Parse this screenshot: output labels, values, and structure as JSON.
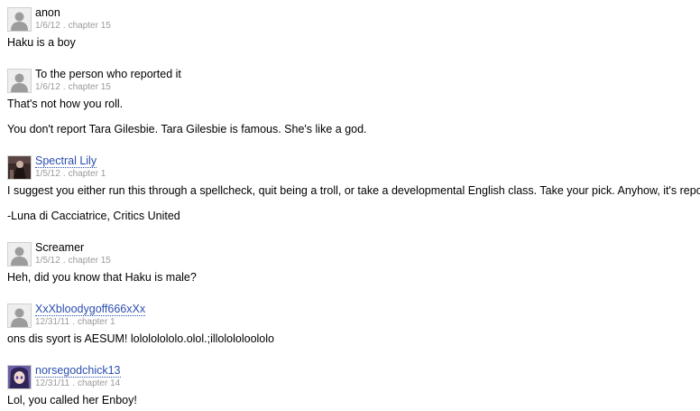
{
  "reviews": [
    {
      "reviewer": "anon",
      "linked": false,
      "avatar_icon": "default-user-icon",
      "date": "1/6/12",
      "separator": ".",
      "chapter": "chapter 15",
      "paragraphs": [
        "Haku is a boy"
      ]
    },
    {
      "reviewer": "To the person who reported it",
      "linked": false,
      "avatar_icon": "default-user-icon",
      "date": "1/6/12",
      "separator": ".",
      "chapter": "chapter 15",
      "paragraphs": [
        "That's not how you roll.",
        "You don't report Tara Gilesbie. Tara Gilesbie is famous. She's like a god."
      ]
    },
    {
      "reviewer": "Spectral Lily",
      "linked": true,
      "avatar_icon": "profile-picture-dark-figure-icon",
      "date": "1/5/12",
      "separator": ".",
      "chapter": "chapter 1",
      "paragraphs": [
        "I suggest you either run this through a spellcheck, quit being a troll, or take a developmental English class. Take your pick. Anyhow, it's reported.",
        "-Luna di Cacciatrice, Critics United"
      ]
    },
    {
      "reviewer": "Screamer",
      "linked": false,
      "avatar_icon": "default-user-icon",
      "date": "1/5/12",
      "separator": ".",
      "chapter": "chapter 15",
      "paragraphs": [
        "Heh, did you know that Haku is male?"
      ]
    },
    {
      "reviewer": "XxXbloodygoff666xXx",
      "linked": true,
      "avatar_icon": "default-user-icon",
      "date": "12/31/11",
      "separator": ".",
      "chapter": "chapter 1",
      "paragraphs": [
        "ons dis syort is AESUM! lolololololo.olol.;illolololoololo"
      ]
    },
    {
      "reviewer": "norsegodchick13",
      "linked": true,
      "avatar_icon": "profile-picture-purple-anime-icon",
      "date": "12/31/11",
      "separator": ".",
      "chapter": "chapter 14",
      "paragraphs": [
        "Lol, you called her Enboy!"
      ]
    }
  ]
}
